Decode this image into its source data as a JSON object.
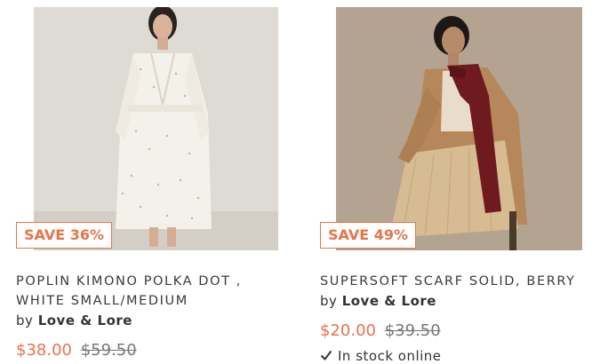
{
  "products": [
    {
      "badge": "SAVE 36%",
      "title": "POPLIN KIMONO POLKA DOT ,\nWHITE SMALL/MEDIUM",
      "vendor_prefix": "by",
      "vendor_name": "Love & Lore",
      "price_sale": "$38.00",
      "price_compare": "$59.50",
      "image_name": "kimono-product-photo"
    },
    {
      "badge": "SAVE 49%",
      "title": "SUPERSOFT SCARF SOLID, BERRY",
      "vendor_prefix": "by",
      "vendor_name": "Love & Lore",
      "price_sale": "$20.00",
      "price_compare": "$39.50",
      "stock_text": "In stock online",
      "stock_icon": "check-icon",
      "image_name": "scarf-product-photo"
    }
  ],
  "colors": {
    "accent": "#e8734a",
    "text": "#333333",
    "muted": "#777777"
  }
}
